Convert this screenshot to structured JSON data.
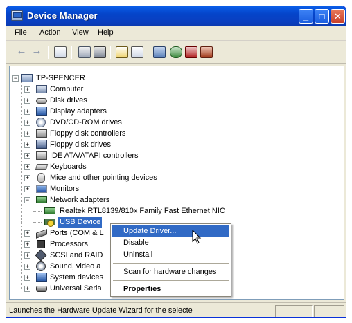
{
  "window": {
    "title": "Device Manager"
  },
  "titlebar_buttons": {
    "minimize": "_",
    "maximize": "□",
    "close": "✕"
  },
  "menubar": {
    "items": [
      "File",
      "Action",
      "View",
      "Help"
    ]
  },
  "toolbar": {
    "back": "←",
    "forward": "→"
  },
  "tree": {
    "root": "TP-SPENCER",
    "categories": [
      "Computer",
      "Disk drives",
      "Display adapters",
      "DVD/CD-ROM drives",
      "Floppy disk controllers",
      "Floppy disk drives",
      "IDE ATA/ATAPI controllers",
      "Keyboards",
      "Mice and other pointing devices",
      "Monitors",
      "Network adapters"
    ],
    "network_children": [
      "Realtek RTL8139/810x Family Fast Ethernet NIC",
      "USB Device"
    ],
    "after_categories": [
      "Ports (COM & L",
      "Processors",
      "SCSI and RAID",
      "Sound, video a",
      "System devices",
      "Universal Seria"
    ],
    "expander_collapsed": "+",
    "expander_expanded": "−"
  },
  "context_menu": {
    "items": [
      "Update Driver...",
      "Disable",
      "Uninstall",
      "Scan for hardware changes",
      "Properties"
    ]
  },
  "statusbar": {
    "text": "Launches the Hardware Update Wizard for the selecte"
  },
  "colors": {
    "titlebar": "#0a4fd6",
    "selection": "#316ac5",
    "window_bg": "#ece9d8",
    "tree_border": "#7f9db9"
  },
  "icons": {
    "window": "device-manager-icon",
    "computer": "computer-icon",
    "disk": "disk-drive-icon",
    "display": "display-adapter-icon",
    "dvd": "dvd-drive-icon",
    "floppy_ctrl": "floppy-controller-icon",
    "floppy": "floppy-drive-icon",
    "ide": "ide-controller-icon",
    "keyboard": "keyboard-icon",
    "mouse": "mouse-icon",
    "monitor": "monitor-icon",
    "network": "network-adapter-icon",
    "nic": "nic-card-icon",
    "warning": "warning-icon",
    "ports": "port-icon",
    "processor": "processor-icon",
    "scsi": "scsi-icon",
    "sound": "sound-icon",
    "system": "system-device-icon",
    "usb": "usb-controller-icon"
  }
}
